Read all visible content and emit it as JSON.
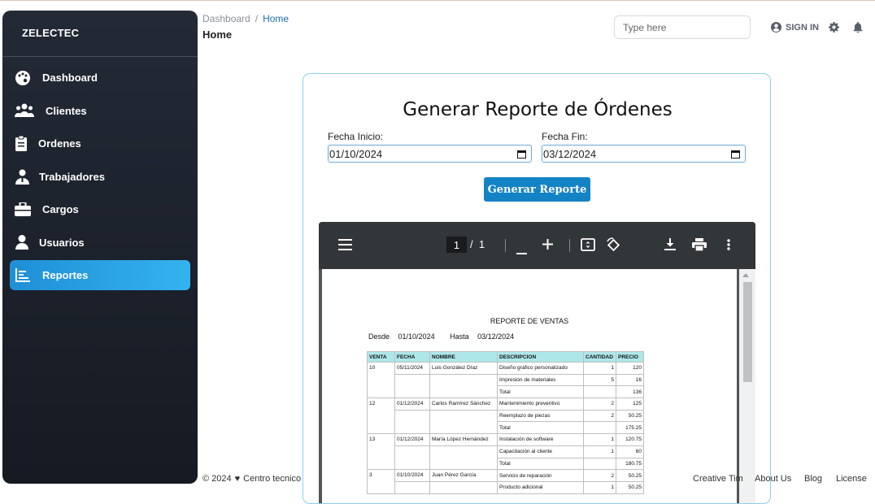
{
  "sidebar": {
    "brand": "ZELECTEC",
    "items": [
      {
        "label": "Dashboard",
        "icon": "palette-icon"
      },
      {
        "label": "Clientes",
        "icon": "users-icon"
      },
      {
        "label": "Ordenes",
        "icon": "clipboard-icon"
      },
      {
        "label": "Trabajadores",
        "icon": "worker-icon"
      },
      {
        "label": "Cargos",
        "icon": "briefcase-icon"
      },
      {
        "label": "Usuarios",
        "icon": "user-icon"
      },
      {
        "label": "Reportes",
        "icon": "chart-icon",
        "active": true
      }
    ]
  },
  "header": {
    "breadcrumb_root": "Dashboard",
    "breadcrumb_separator": "/",
    "breadcrumb_current": "Home",
    "title": "Home",
    "search_placeholder": "Type here",
    "signin_label": "SIGN IN"
  },
  "form": {
    "title": "Generar Reporte de Órdenes",
    "start_label": "Fecha Inicio:",
    "start_value": "01/10/2024",
    "end_label": "Fecha Fin:",
    "end_value": "03/12/2024",
    "button_label": "Generar Reporte"
  },
  "pdf_viewer": {
    "current_page": "1",
    "page_separator": "/",
    "total_pages": "1",
    "report": {
      "title": "REPORTE DE VENTAS",
      "from_label": "Desde",
      "from_value": "01/10/2024",
      "to_label": "Hasta",
      "to_value": "03/12/2024",
      "columns": [
        "VENTA",
        "FECHA",
        "NOMBRE",
        "DESCRIPCION",
        "CANTIDAD",
        "PRECIO"
      ],
      "sales": [
        {
          "venta": "10",
          "fecha": "05/11/2024",
          "nombre": "Luis González Díaz",
          "items": [
            {
              "desc": "Diseño gráfico personalizado",
              "qty": "1",
              "price": "120"
            },
            {
              "desc": "Impresión de materiales",
              "qty": "5",
              "price": "16"
            },
            {
              "desc": "Total",
              "qty": "",
              "price": "136"
            }
          ]
        },
        {
          "venta": "12",
          "fecha": "01/12/2024",
          "nombre": "Carlos Ramírez Sánchez",
          "items": [
            {
              "desc": "Mantenimiento preventivo",
              "qty": "2",
              "price": "125"
            },
            {
              "desc": "Reemplazo de piezas",
              "qty": "2",
              "price": "50.25"
            },
            {
              "desc": "Total",
              "qty": "",
              "price": "175.25"
            }
          ]
        },
        {
          "venta": "13",
          "fecha": "01/12/2024",
          "nombre": "María López Hernández",
          "items": [
            {
              "desc": "Instalación de software",
              "qty": "1",
              "price": "120.75"
            },
            {
              "desc": "Capacitación al cliente",
              "qty": "1",
              "price": "60"
            },
            {
              "desc": "Total",
              "qty": "",
              "price": "180.75"
            }
          ]
        },
        {
          "venta": "3",
          "fecha": "01/10/2024",
          "nombre": "Juan Pérez García",
          "items": [
            {
              "desc": "Servicio de reparación",
              "qty": "2",
              "price": "50.25"
            },
            {
              "desc": "Producto adicional",
              "qty": "1",
              "price": "50.25"
            }
          ]
        }
      ]
    }
  },
  "footer": {
    "copyright": "© 2024",
    "credit": "Centro tecnico",
    "links": [
      "Creative Tim",
      "About Us",
      "Blog",
      "License"
    ]
  },
  "colors": {
    "sidebar_bg": "#1b2029",
    "active_item": "#2aa3e6",
    "button": "#1483c6",
    "card_border": "#8ad0ef",
    "table_header": "#aee7ea"
  }
}
